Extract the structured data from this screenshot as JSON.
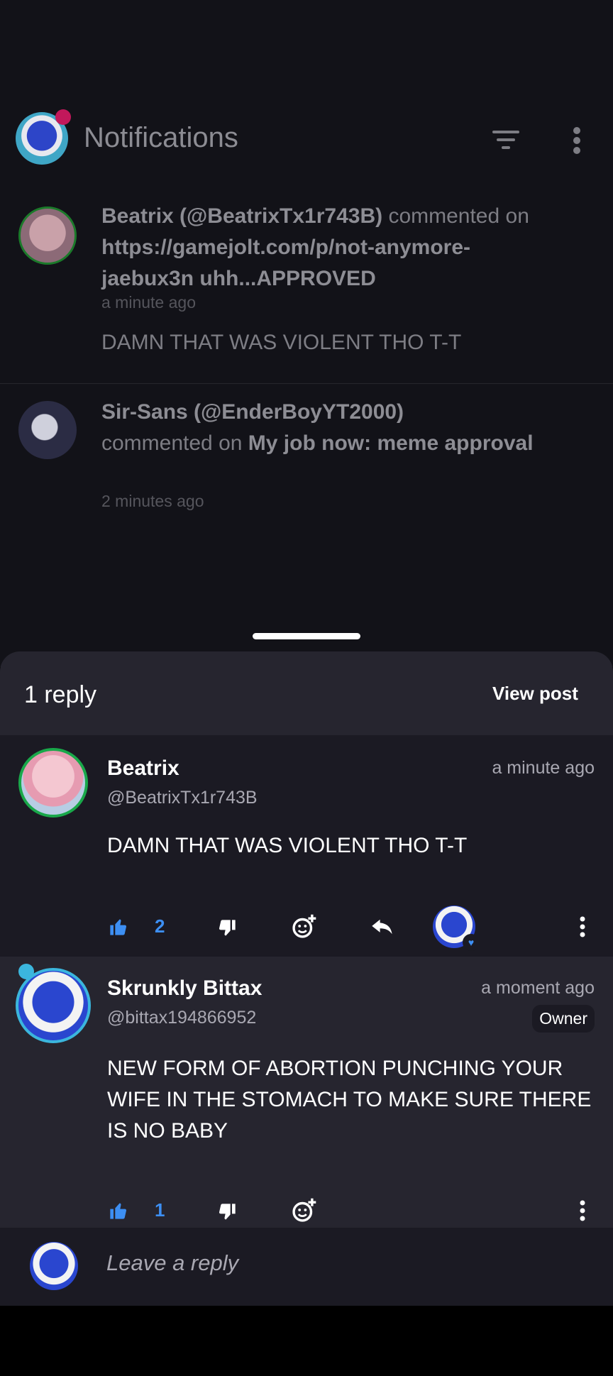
{
  "background": {
    "title": "Notifications",
    "notifications": [
      {
        "user": "Beatrix (@BeatrixTx1r743B)",
        "action": "commented on",
        "target": "https://gamejolt.com/p/not-anymore-jaebux3n uhh...APPROVED",
        "time": "a minute ago",
        "body": "DAMN THAT WAS VIOLENT THO T-T"
      },
      {
        "user": "Sir-Sans (@EnderBoyYT2000)",
        "action": "commented on",
        "target": "My job now: meme approval",
        "time": "2 minutes ago"
      }
    ]
  },
  "sheet": {
    "reply_count": "1 reply",
    "view_post": "View post",
    "comments": [
      {
        "name": "Beatrix",
        "handle": "@BeatrixTx1r743B",
        "time": "a minute ago",
        "body": "DAMN THAT WAS VIOLENT THO T-T",
        "likes": "2"
      },
      {
        "name": "Skrunkly Bittax",
        "handle": "@bittax194866952",
        "time": "a moment ago",
        "badge": "Owner",
        "body": "NEW FORM OF ABORTION PUNCHING YOUR WIFE IN THE STOMACH TO MAKE SURE THERE IS NO BABY",
        "likes": "1"
      }
    ],
    "reply_placeholder": "Leave a reply"
  },
  "colors": {
    "accent_blue": "#3d8ff3",
    "sheet_bg": "#26252f",
    "card_bg": "#1b1a23",
    "online_green": "#19a84a"
  }
}
